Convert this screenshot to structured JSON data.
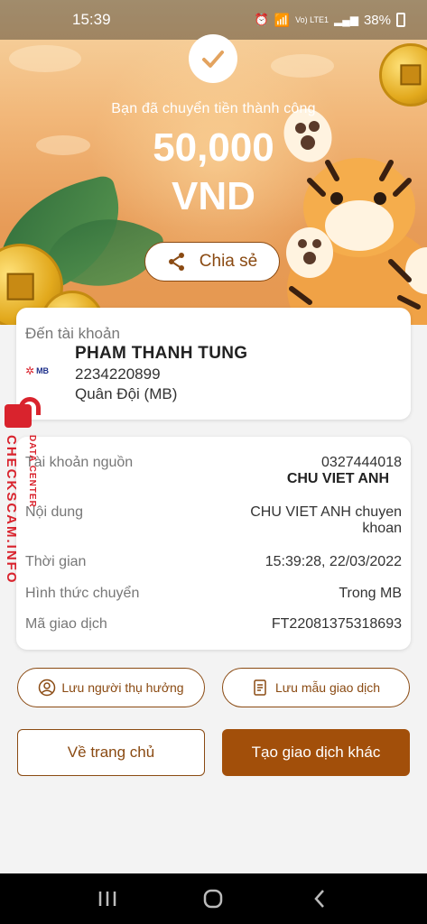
{
  "status_bar": {
    "time": "15:39",
    "network": "Vo) LTE1",
    "battery": "38%"
  },
  "hero": {
    "success_message": "Bạn đã chuyển tiền thành công",
    "amount": "50,000",
    "currency": "VND",
    "share_label": "Chia sẻ"
  },
  "recipient": {
    "label": "Đến tài khoản",
    "name": "PHAM THANH TUNG",
    "account_number": "2234220899",
    "bank": "Quân Đội (MB)",
    "bank_logo": "MB"
  },
  "details": [
    {
      "label": "Tài khoản nguồn",
      "value": "0327444018",
      "value2": "CHU VIET ANH"
    },
    {
      "label": "Nội dung",
      "value": "CHU VIET ANH chuyen",
      "value2": "khoan"
    },
    {
      "label": "Thời gian",
      "value": "15:39:28, 22/03/2022"
    },
    {
      "label": "Hình thức chuyển",
      "value": "Trong MB"
    },
    {
      "label": "Mã giao dịch",
      "value": "FT22081375318693"
    }
  ],
  "actions": {
    "save_beneficiary": "Lưu người thụ hưởng",
    "save_template": "Lưu mẫu giao dịch",
    "home": "Về trang chủ",
    "new_transaction": "Tạo giao dịch khác"
  },
  "watermark": {
    "text": "CHECKSCAM.INFO",
    "sub": "DATA CENTER"
  },
  "colors": {
    "accent": "#a24f0a",
    "outline": "#8a4a12",
    "watermark": "#d9232d"
  }
}
